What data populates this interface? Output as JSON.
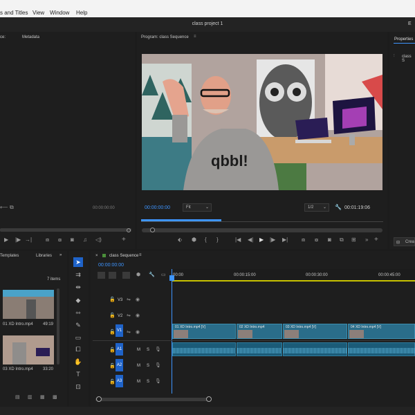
{
  "menu": {
    "items": [
      "s and Titles",
      "View",
      "Window",
      "Help"
    ]
  },
  "window": {
    "title": "class project 1",
    "right_label": "E"
  },
  "source_panel": {
    "tab1": "ce:",
    "tab2": "Metadata",
    "timecode": "00:00:00:00"
  },
  "program_monitor": {
    "header": "Program: class Sequence",
    "current_time": "00:00:00:00",
    "zoom": "Fit",
    "resolution": "1/2",
    "duration": "00:01:19:06"
  },
  "properties_panel": {
    "tab": "Properties",
    "item": "class S",
    "create_label": "Crea"
  },
  "project_panel": {
    "tab1": "Templates",
    "tab2": "Libraries",
    "count": "7 items",
    "clips": [
      {
        "name": "01 XD Intro.mp4",
        "duration": "49:19"
      },
      {
        "name": "03 XD Intro.mp4",
        "duration": "33:20"
      }
    ]
  },
  "timeline": {
    "tab": "class Sequence",
    "timecode": "00:00:00:00",
    "ruler": [
      "00:00",
      "00:00:15:00",
      "00:00:30:00",
      "00:00:45:00"
    ],
    "video_tracks": [
      "V3",
      "V2",
      "V1"
    ],
    "audio_tracks": [
      "A1",
      "A2",
      "A3"
    ],
    "clips": [
      "01 XD Intro.mp4 [V]",
      "02 XD Intro.mp4",
      "03 XD Intro.mp4 [V]",
      "04 XD Intro.mp4 [V]"
    ]
  },
  "icons": [
    "selection-tool-icon",
    "track-select-icon",
    "ripple-edit-icon",
    "razor-icon",
    "slip-icon",
    "pen-icon",
    "rectangle-icon",
    "hand-icon",
    "type-icon",
    "play-icon",
    "wrench-icon"
  ]
}
